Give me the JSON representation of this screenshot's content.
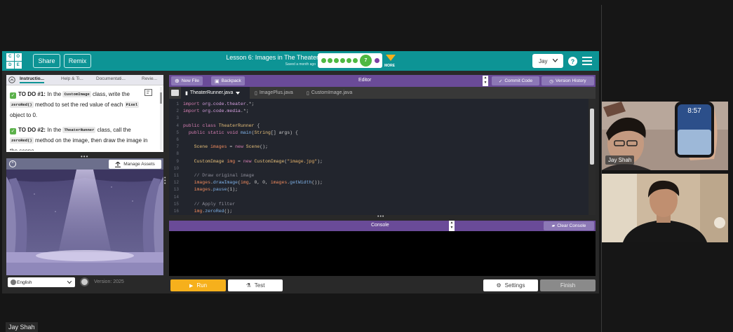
{
  "header": {
    "logo": [
      "C",
      "O",
      "D",
      "E"
    ],
    "share_label": "Share",
    "remix_label": "Remix",
    "lesson_title": "Lesson 6: Images in The Theater",
    "saved_text": "Saved a month ago",
    "current_level": "7",
    "more_label": "MORE",
    "user_name": "Jay",
    "help_glyph": "?"
  },
  "instructions": {
    "tabs": [
      "Instructio...",
      "Help & Ti...",
      "Documentati...",
      "Revie..."
    ],
    "todo1": {
      "label": "TO DO #1:",
      "text_a": "In the",
      "code_a": "CustomImage",
      "text_b": "class, write the",
      "code_b": "zeroRed()",
      "text_c": "method to set the red value of each",
      "code_c": "Pixel",
      "text_d": "object to 0."
    },
    "todo2": {
      "label": "TO DO #2:",
      "text_a": "In the",
      "code_a": "TheaterRunner",
      "text_b": "class, call the",
      "code_b": "zeroRed()",
      "text_c": "method on the image, then draw the image in the scene."
    }
  },
  "visualization": {
    "manage_assets_label": "Manage Assets"
  },
  "footer_left": {
    "language": "English",
    "version": "Version: 2025"
  },
  "editor": {
    "title": "Editor",
    "new_file_label": "New File",
    "backpack_label": "Backpack",
    "commit_label": "Commit Code",
    "history_label": "Version History",
    "files": [
      "TheaterRunner.java",
      "ImagePlus.java",
      "CustomImage.java"
    ],
    "lines": [
      {
        "n": "1",
        "t": "import org.code.theater.*;"
      },
      {
        "n": "2",
        "t": "import org.code.media.*;"
      },
      {
        "n": "3",
        "t": ""
      },
      {
        "n": "4",
        "t": "public class TheaterRunner {"
      },
      {
        "n": "5",
        "t": "  public static void main(String[] args) {"
      },
      {
        "n": "6",
        "t": ""
      },
      {
        "n": "7",
        "t": "    Scene images = new Scene();"
      },
      {
        "n": "8",
        "t": ""
      },
      {
        "n": "9",
        "t": "    CustomImage img = new CustomImage(\"image.jpg\");"
      },
      {
        "n": "10",
        "t": ""
      },
      {
        "n": "11",
        "t": "    // Draw original image"
      },
      {
        "n": "12",
        "t": "    images.drawImage(img, 0, 0, images.getWidth());"
      },
      {
        "n": "13",
        "t": "    images.pause(1);"
      },
      {
        "n": "14",
        "t": ""
      },
      {
        "n": "15",
        "t": "    // Apply filter"
      },
      {
        "n": "16",
        "t": "    img.zeroRed();"
      }
    ]
  },
  "console": {
    "title": "Console",
    "clear_label": "Clear Console"
  },
  "actions": {
    "run_label": "Run",
    "test_label": "Test",
    "settings_label": "Settings",
    "finish_label": "Finish"
  },
  "video": {
    "tile1_name": "Jay Shah",
    "phone_time": "8:57",
    "bottom_name": "Jay Shah"
  },
  "colors": {
    "header": "#0d9495",
    "purple": "#6a4b98",
    "run": "#f6b01c"
  }
}
